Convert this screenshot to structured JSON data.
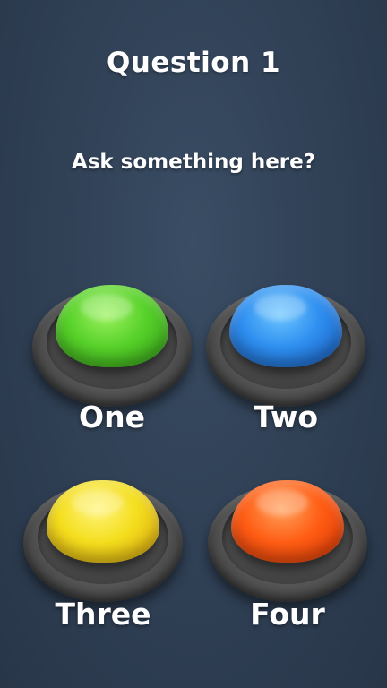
{
  "header": {
    "title": "Question 1",
    "question": "Ask something here?"
  },
  "answers": [
    {
      "label": "One",
      "color": "#57d12a"
    },
    {
      "label": "Two",
      "color": "#2f8ff0"
    },
    {
      "label": "Three",
      "color": "#f4de1e"
    },
    {
      "label": "Four",
      "color": "#ff5d14"
    }
  ]
}
